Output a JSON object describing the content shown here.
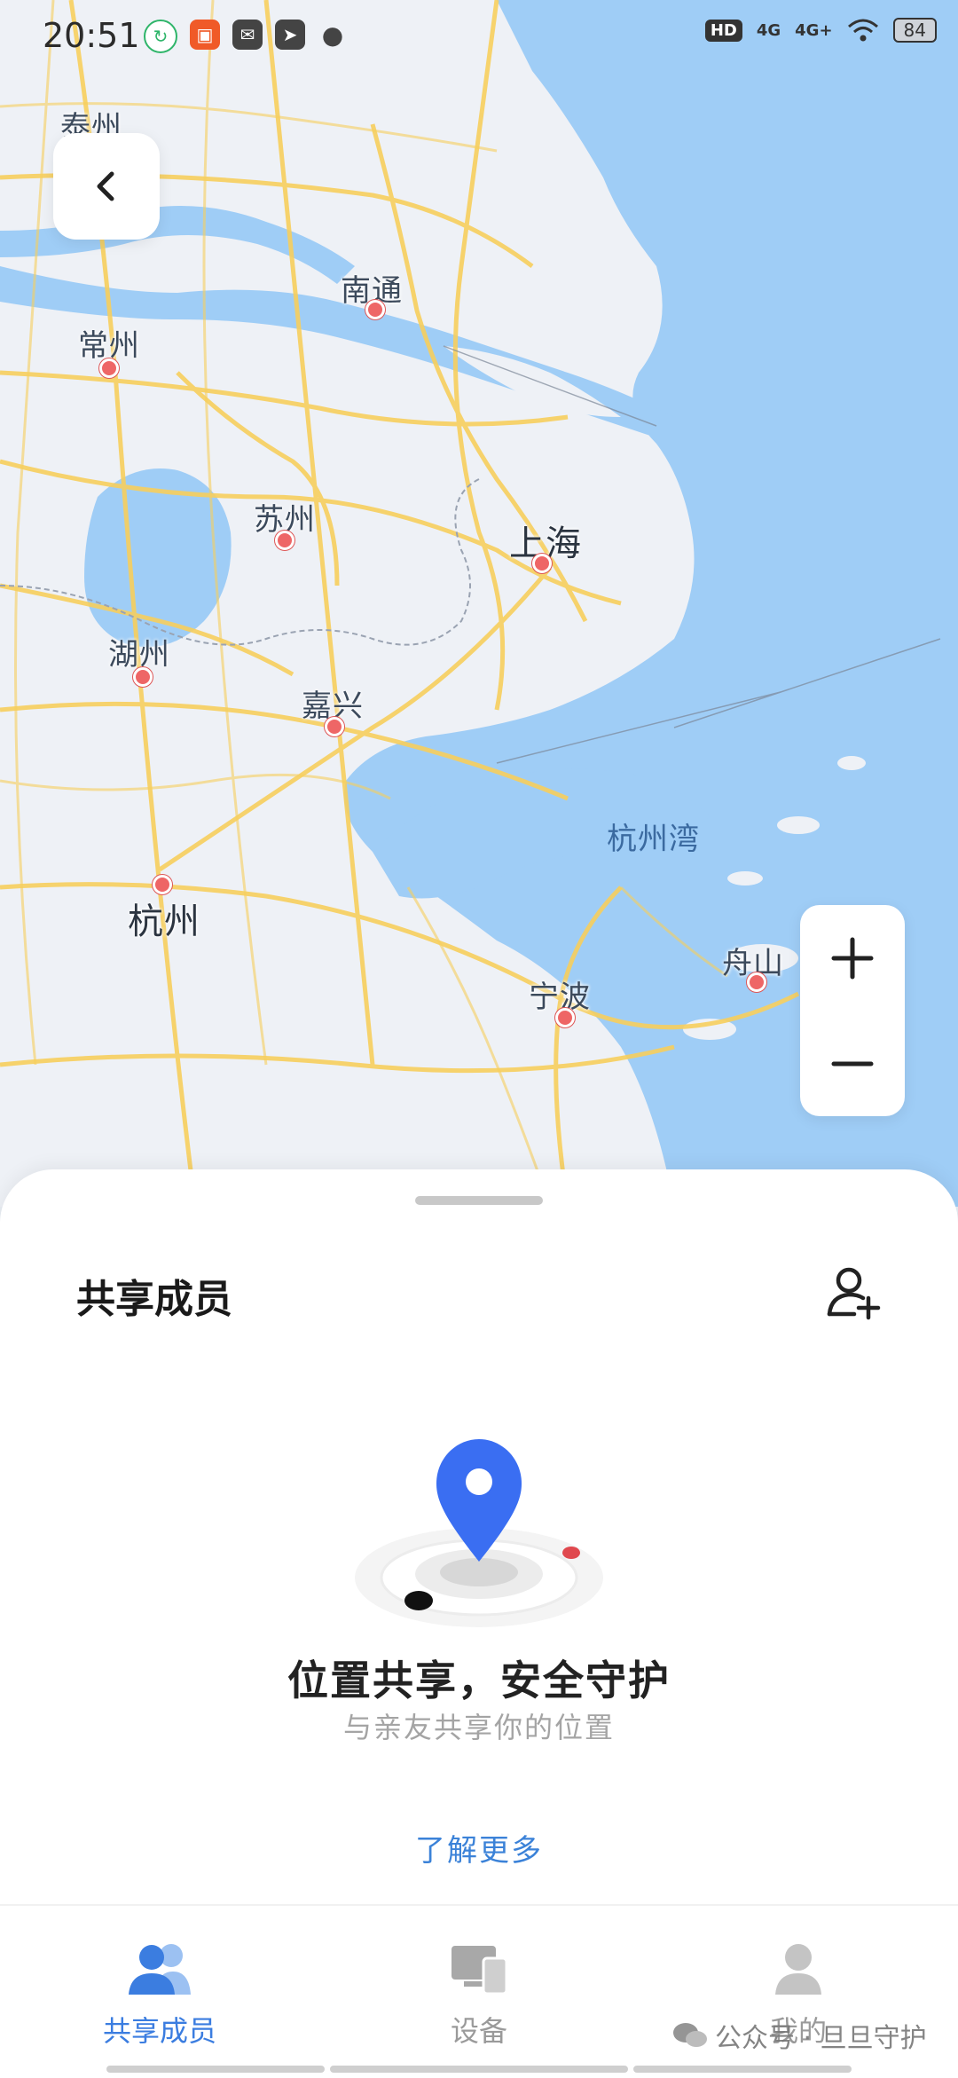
{
  "status_bar": {
    "time": "20:51",
    "hd_label": "HD",
    "signal1": "4G",
    "signal2": "4G+",
    "battery": "84"
  },
  "map": {
    "cities": [
      {
        "name": "泰州"
      },
      {
        "name": "南通"
      },
      {
        "name": "常州"
      },
      {
        "name": "苏州"
      },
      {
        "name": "上海"
      },
      {
        "name": "湖州"
      },
      {
        "name": "嘉兴"
      },
      {
        "name": "杭州湾"
      },
      {
        "name": "杭州"
      },
      {
        "name": "宁波"
      },
      {
        "name": "舟山"
      }
    ]
  },
  "sheet": {
    "title": "共享成员",
    "empty_title": "位置共享，安全守护",
    "empty_subtitle": "与亲友共享你的位置",
    "learn_more": "了解更多"
  },
  "tabs": [
    {
      "label": "共享成员",
      "icon": "people-icon",
      "active": true
    },
    {
      "label": "设备",
      "icon": "devices-icon",
      "active": false
    },
    {
      "label": "我的",
      "icon": "person-icon",
      "active": false
    }
  ],
  "watermark": "公众号 · 旦旦守护",
  "colors": {
    "accent": "#3b7de0",
    "pin": "#3a6ef2",
    "sea": "#9fcdf6",
    "road": "#f7cf5e"
  }
}
